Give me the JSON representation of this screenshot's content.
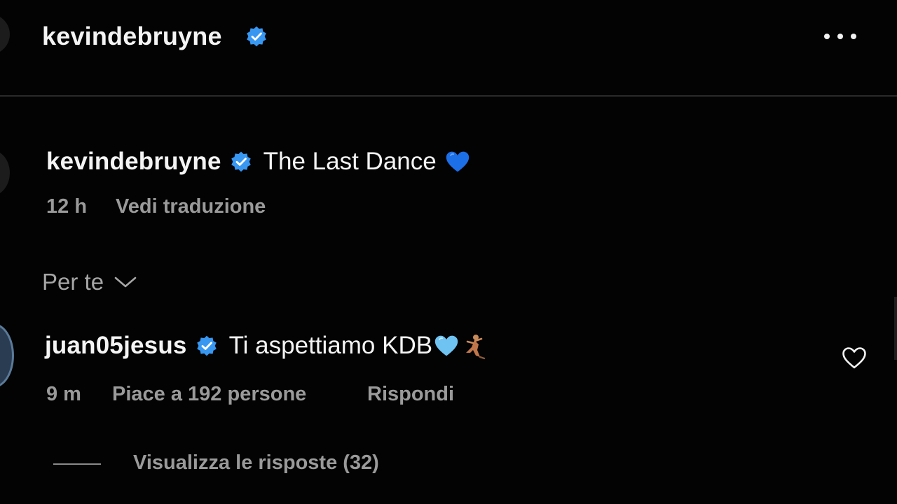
{
  "header": {
    "username": "kevindebruyne",
    "verified_color": "#3897f0",
    "more_icon": "more-horizontal-icon"
  },
  "caption": {
    "username": "kevindebruyne",
    "text": "The Last Dance",
    "emoji": "blue-heart-icon",
    "time": "12 h",
    "translate_label": "Vedi traduzione"
  },
  "filter": {
    "label": "Per te",
    "icon": "chevron-down-icon"
  },
  "comment": {
    "username": "juan05jesus",
    "text": "Ti aspettiamo KDB",
    "emojis": [
      "light-blue-heart-icon",
      "dancer-icon"
    ],
    "time": "9 m",
    "likes_label": "Piace a 192 persone",
    "reply_label": "Rispondi",
    "like_icon": "heart-outline-icon"
  },
  "replies": {
    "label": "Visualizza le risposte (32)"
  },
  "colors": {
    "background": "#030303",
    "primary_text": "#f4f4f4",
    "secondary_text": "#9a9a9a",
    "verified": "#3897f0",
    "blue_heart": "#1d6fe8",
    "light_blue_heart": "#6fc3f2"
  }
}
